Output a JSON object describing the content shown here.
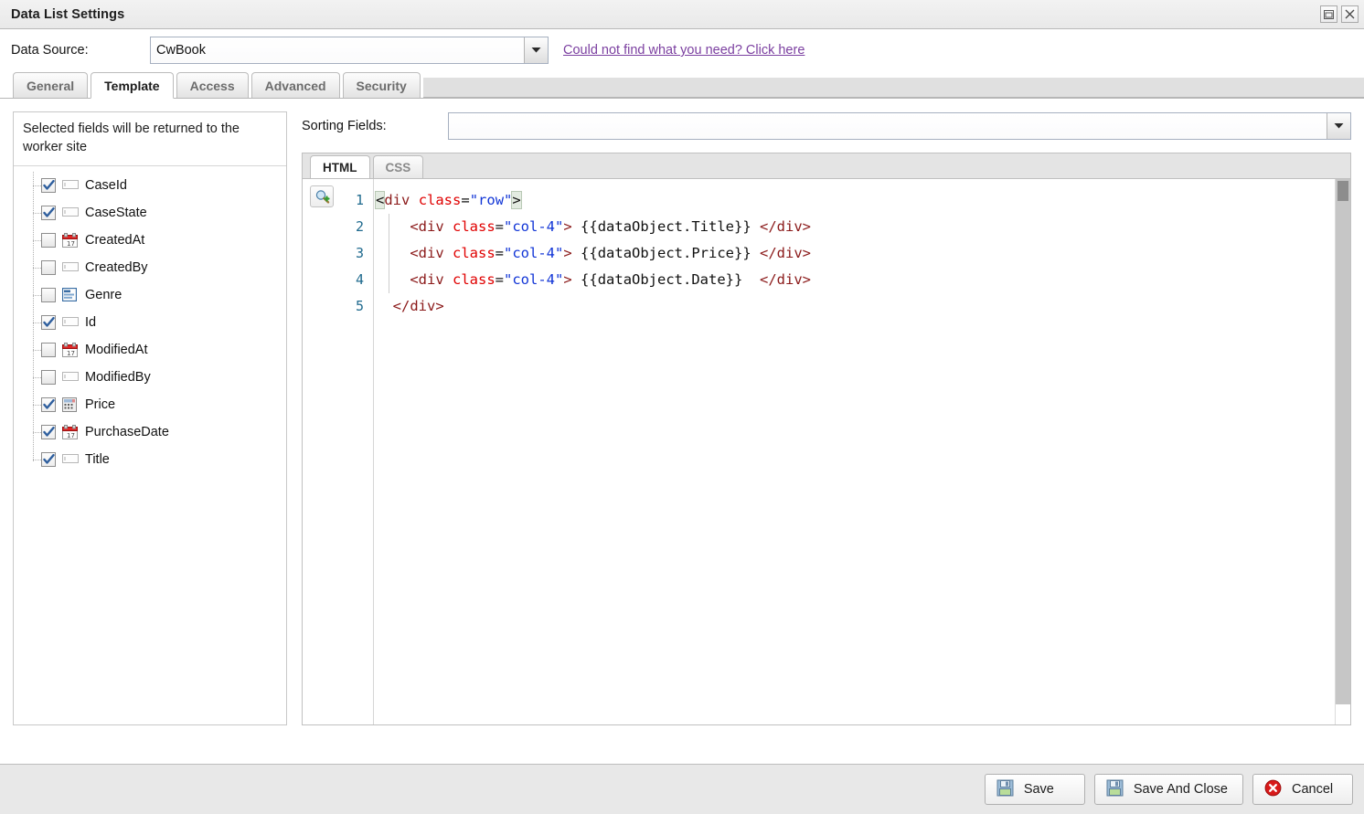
{
  "window": {
    "title": "Data List Settings",
    "controls": [
      {
        "name": "restore-button",
        "icon": "restore-icon"
      },
      {
        "name": "close-button",
        "icon": "close-icon"
      }
    ]
  },
  "data_source": {
    "label": "Data Source:",
    "value": "CwBook",
    "placeholder": "",
    "arrow_icon": "chevron-down-icon",
    "help_link": "Could not find what you need? Click here",
    "link_color": "#7b3fa0"
  },
  "tabs": [
    {
      "label": "General",
      "active": false
    },
    {
      "label": "Template",
      "active": true
    },
    {
      "label": "Access",
      "active": false
    },
    {
      "label": "Advanced",
      "active": false
    },
    {
      "label": "Security",
      "active": false
    }
  ],
  "fields_panel": {
    "header": "Selected fields will be returned to the worker site",
    "items": [
      {
        "label": "CaseId",
        "checked": true,
        "type": "text"
      },
      {
        "label": "CaseState",
        "checked": true,
        "type": "text"
      },
      {
        "label": "CreatedAt",
        "checked": false,
        "type": "date"
      },
      {
        "label": "CreatedBy",
        "checked": false,
        "type": "text"
      },
      {
        "label": "Genre",
        "checked": false,
        "type": "choice"
      },
      {
        "label": "Id",
        "checked": true,
        "type": "text"
      },
      {
        "label": "ModifiedAt",
        "checked": false,
        "type": "date"
      },
      {
        "label": "ModifiedBy",
        "checked": false,
        "type": "text"
      },
      {
        "label": "Price",
        "checked": true,
        "type": "number"
      },
      {
        "label": "PurchaseDate",
        "checked": true,
        "type": "date"
      },
      {
        "label": "Title",
        "checked": true,
        "type": "text"
      }
    ]
  },
  "sorting": {
    "label": "Sorting Fields:",
    "value": "",
    "arrow_icon": "chevron-down-icon"
  },
  "editor": {
    "tabs": [
      {
        "label": "HTML",
        "active": true
      },
      {
        "label": "CSS",
        "active": false
      }
    ],
    "gutter_icon": "zoom-in-icon",
    "line_numbers": [
      "1",
      "2",
      "3",
      "4",
      "5"
    ],
    "lines": [
      "<div class=\"row\">",
      "    <div class=\"col-4\"> {{dataObject.Title}} </div>",
      "    <div class=\"col-4\"> {{dataObject.Price}} </div>",
      "    <div class=\"col-4\"> {{dataObject.Date}}  </div>",
      "</div>"
    ],
    "scrollbar": {
      "name": "editor-vertical-scrollbar"
    }
  },
  "footer": {
    "buttons": [
      {
        "label": "Save",
        "icon": "save-icon",
        "name": "save-button"
      },
      {
        "label": "Save And Close",
        "icon": "save-icon",
        "name": "save-and-close-button"
      },
      {
        "label": "Cancel",
        "icon": "cancel-icon",
        "name": "cancel-button"
      }
    ]
  }
}
